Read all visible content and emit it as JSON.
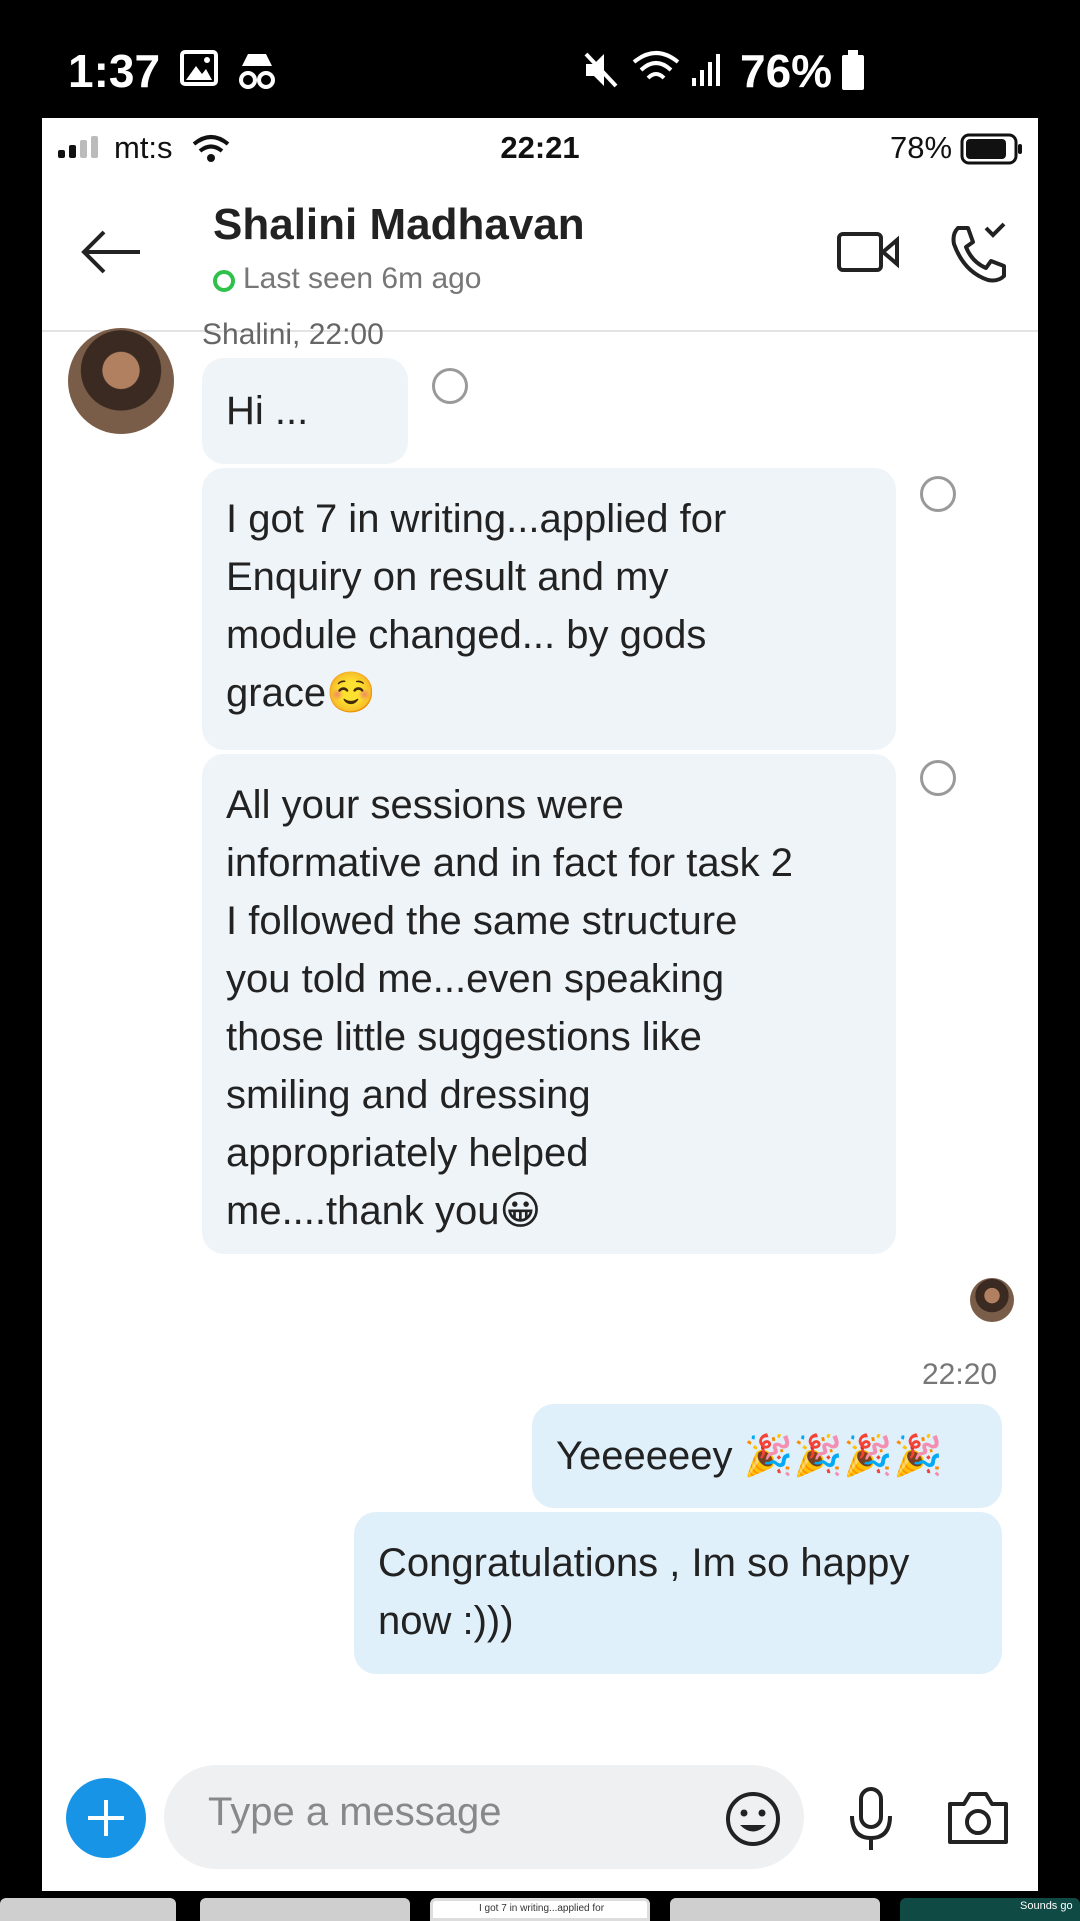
{
  "outer_status": {
    "time": "1:37",
    "battery": "76%",
    "icons": [
      "image-icon",
      "incognito-icon",
      "mute-icon",
      "wifi-icon",
      "signal-icon",
      "battery-icon"
    ]
  },
  "ios_status": {
    "carrier": "mt:s",
    "time": "22:21",
    "battery": "78%"
  },
  "header": {
    "name": "Shalini Madhavan",
    "last_seen": "Last seen 6m ago"
  },
  "messages": {
    "sender_meta": "Shalini, 22:00",
    "in_1": "Hi ...",
    "in_2_lines": [
      "I got 7 in writing...applied for",
      "Enquiry on result and my",
      "module changed... by gods",
      "grace☺️"
    ],
    "in_3_lines": [
      "All your sessions were",
      "informative and in fact for task 2",
      "I followed the same structure",
      "you told me...even speaking",
      "those little suggestions like",
      "smiling and dressing",
      "appropriately helped",
      "me....thank you😀"
    ],
    "out_time": "22:20",
    "out_1": "Yeeeeeey 🎉🎉🎉🎉",
    "out_2_lines": [
      "Congratulations , Im so happy",
      "now :)))"
    ]
  },
  "composer": {
    "placeholder": "Type a message"
  },
  "thumb_strip": {
    "active_caption": "I got 7 in writing...applied for",
    "right_caption": "Sounds go"
  },
  "colors": {
    "accent": "#1894e6",
    "online": "#2ec24b",
    "incoming_bubble": "#eef4f8",
    "outgoing_bubble": "#dff0fb"
  }
}
